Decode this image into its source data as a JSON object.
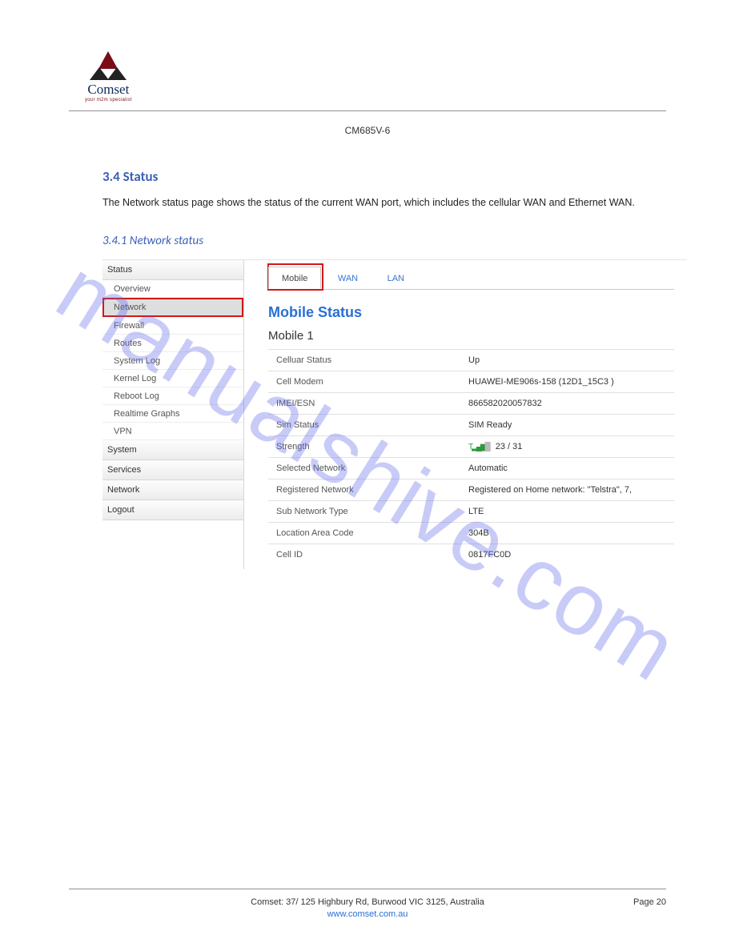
{
  "doc": {
    "brand_name": "Comset",
    "brand_tagline": "your m2m specialist",
    "model": "CM685V-6",
    "section_heading": "3.4 Status",
    "subsection_heading": "3.4.1 Network status",
    "paragraph": "The Network status page shows the status of the current WAN port, which includes the cellular WAN and Ethernet WAN.",
    "footer_address": "Comset: 37/ 125 Highbury Rd, Burwood VIC 3125, Australia",
    "footer_url": "www.comset.com.au",
    "footer_page": "Page 20"
  },
  "sidebar": {
    "sections": [
      {
        "label": "Status",
        "items": [
          "Overview",
          "Network",
          "Firewall",
          "Routes",
          "System Log",
          "Kernel Log",
          "Reboot Log",
          "Realtime Graphs",
          "VPN"
        ],
        "selected_index": 1
      },
      {
        "label": "System",
        "items": []
      },
      {
        "label": "Services",
        "items": []
      },
      {
        "label": "Network",
        "items": []
      },
      {
        "label": "Logout",
        "items": []
      }
    ]
  },
  "tabs": {
    "items": [
      "Mobile",
      "WAN",
      "LAN"
    ],
    "active_index": 0
  },
  "main": {
    "title": "Mobile Status",
    "subtitle": "Mobile 1",
    "rows": [
      {
        "k": "Celluar Status",
        "v": "Up"
      },
      {
        "k": "Cell Modem",
        "v": "HUAWEI-ME906s-158 (12D1_15C3 )"
      },
      {
        "k": "IMEI/ESN",
        "v": "866582020057832"
      },
      {
        "k": "Sim Status",
        "v": "SIM Ready"
      },
      {
        "k": "Strength",
        "v": "23 / 31",
        "signal": true
      },
      {
        "k": "Selected Network",
        "v": "Automatic"
      },
      {
        "k": "Registered Network",
        "v": "Registered on Home network: \"Telstra\", 7,"
      },
      {
        "k": "Sub Network Type",
        "v": "LTE"
      },
      {
        "k": "Location Area Code",
        "v": "304B"
      },
      {
        "k": "Cell ID",
        "v": "0817FC0D"
      }
    ]
  },
  "watermark": "manualshive.com"
}
